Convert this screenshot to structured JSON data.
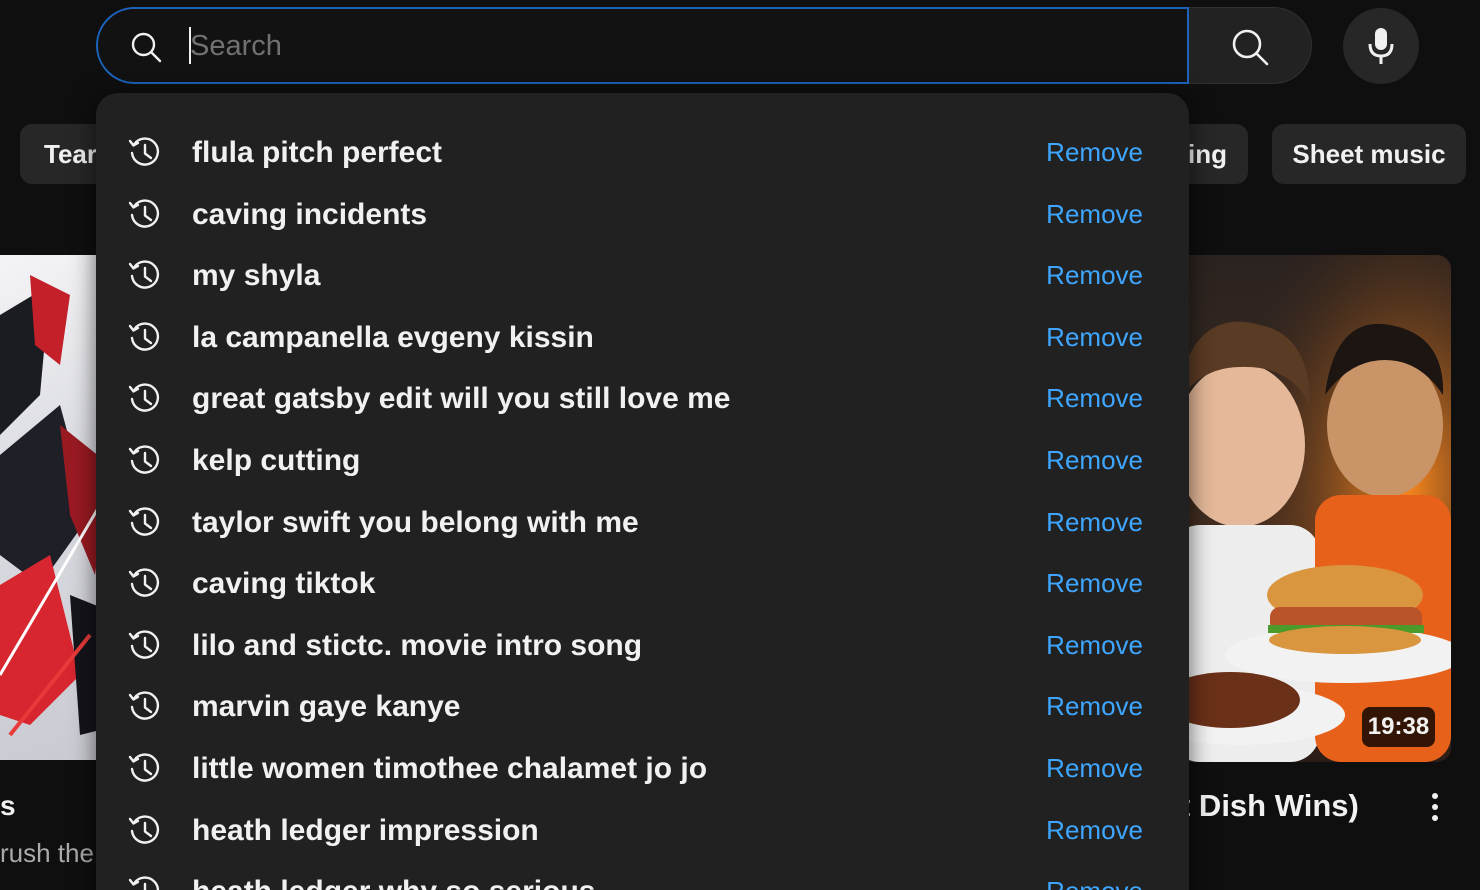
{
  "search": {
    "placeholder": "Search",
    "value": ""
  },
  "chips": {
    "left_partial": "Tear",
    "mid_partial": "ing",
    "sheet_music": "Sheet music"
  },
  "video_left": {
    "title_fragment": "s",
    "subtitle_fragment": "rush the"
  },
  "video_right": {
    "duration": "19:38",
    "title_fragment": "t Dish Wins)"
  },
  "dropdown": {
    "remove_label": "Remove",
    "suggestions": [
      "flula pitch perfect",
      "caving incidents",
      "my shyla",
      "la campanella evgeny kissin",
      "great gatsby edit will you still love me",
      "kelp cutting",
      "taylor swift you belong with me",
      "caving tiktok",
      "lilo and stictc. movie intro song",
      "marvin gaye kanye",
      "little women timothee chalamet jo jo",
      "heath ledger impression",
      "heath ledger why so serious"
    ]
  },
  "colors": {
    "background": "#0f0f0f",
    "dropdown_bg": "#212121",
    "focus_border": "#1c62b9",
    "remove_link": "#3ea6ff"
  },
  "icons": {
    "search": "search-icon",
    "mic": "microphone-icon",
    "history": "history-icon",
    "more": "more-vert-icon"
  }
}
